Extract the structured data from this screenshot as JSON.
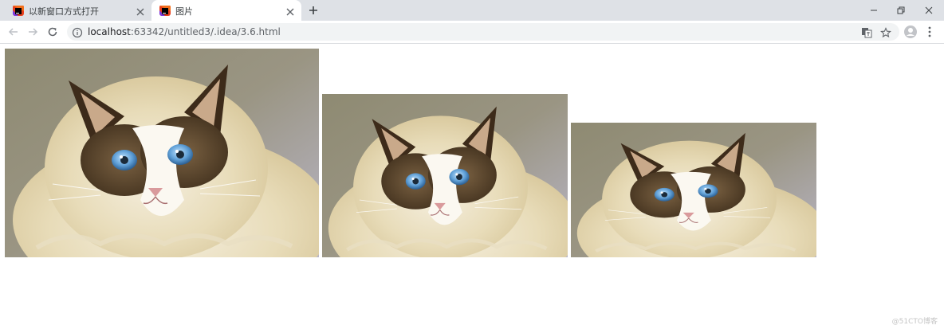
{
  "tabs": [
    {
      "title": "以新窗口方式打开",
      "favicon": "intellij-icon",
      "active": false
    },
    {
      "title": "图片",
      "favicon": "intellij-icon",
      "active": true
    }
  ],
  "address": {
    "host": "localhost",
    "rest": ":63342/untitled3/.idea/3.6.html"
  },
  "images": [
    {
      "alt": "ragdoll-cat-photo"
    },
    {
      "alt": "ragdoll-cat-photo"
    },
    {
      "alt": "ragdoll-cat-photo"
    }
  ],
  "watermark": "@51CTO博客"
}
